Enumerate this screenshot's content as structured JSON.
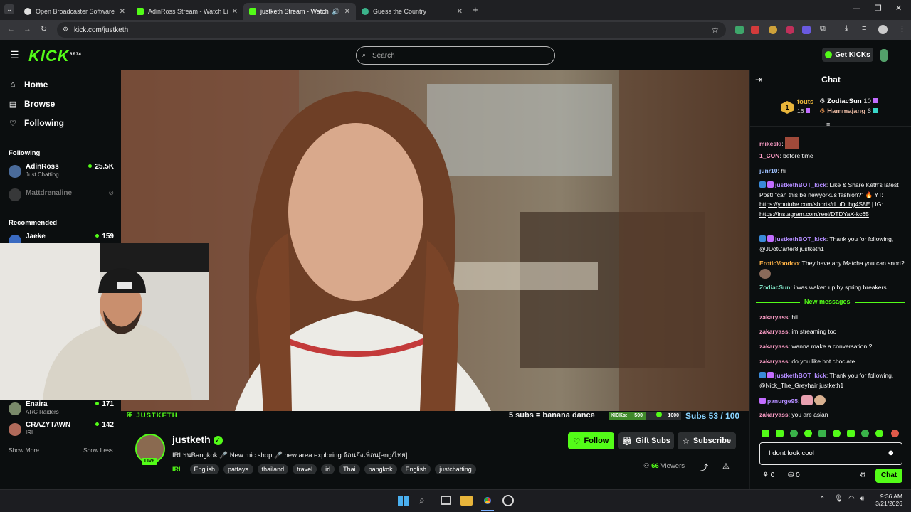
{
  "browser": {
    "tabs": [
      {
        "title": "Open Broadcaster Software | OBS",
        "favicon_color": "#e0e0e0",
        "active": false
      },
      {
        "title": "AdinRoss Stream - Watch Live on Kick",
        "favicon_color": "#53fc18",
        "active": false
      },
      {
        "title": "justketh Stream - Watch Live on Kick",
        "favicon_color": "#53fc18",
        "active": true
      },
      {
        "title": "Guess the Country",
        "favicon_color": "#3bb38a",
        "active": false
      }
    ],
    "url": "kick.com/justketh"
  },
  "header": {
    "logo_text": "KICK",
    "logo_beta": "BETA",
    "search_placeholder": "Search",
    "get_kicks_label": "Get KICKs",
    "accent": "#53fc18"
  },
  "sidebar": {
    "nav": [
      {
        "icon": "home-icon",
        "label": "Home"
      },
      {
        "icon": "browse-icon",
        "label": "Browse"
      },
      {
        "icon": "heart-icon",
        "label": "Following"
      }
    ],
    "following_title": "Following",
    "following": [
      {
        "name": "AdinRoss",
        "category": "Just Chatting",
        "viewers": "25.5K"
      },
      {
        "name": "Mattdrenaline",
        "offline": true
      }
    ],
    "recommended_title": "Recommended",
    "recommended": [
      {
        "name": "Jaeke",
        "viewers": "159"
      },
      {
        "name": "Enaira",
        "category": "ARC Raiders",
        "viewers": "171"
      },
      {
        "name": "CRAZYTAWN",
        "category": "IRL",
        "viewers": "142"
      }
    ],
    "show_more": "Show More",
    "show_less": "Show Less"
  },
  "overlay": {
    "channel_tag": "JUSTKETH",
    "goal_text": "5 subs = banana dance",
    "kicks_label": "KICKs:",
    "kicks_value": "500",
    "kicks_goal": "1000",
    "subs_text": "Subs 53 / 100"
  },
  "stream": {
    "channel_name": "justketh",
    "live_label": "LIVE",
    "title": "IRLฯนBangkok 🎤 New mic shop 🎤 new area exploring จ้อนยังเพื่อน[eng/ไทย]",
    "category": "IRL",
    "tags": [
      "English",
      "pattaya",
      "thailand",
      "travel",
      "irl",
      "Thai",
      "bangkok",
      "English",
      "justchatting"
    ],
    "follow_label": "Follow",
    "gift_label": "Gift Subs",
    "subscribe_label": "Subscribe",
    "viewers_count": "66",
    "viewers_label": "Viewers"
  },
  "chat": {
    "title": "Chat",
    "leaderboard": [
      {
        "name": "fouts",
        "count": "16"
      },
      {
        "name": "ZodiacSun",
        "count": "10"
      },
      {
        "name": "Hammajang",
        "count": "6"
      }
    ],
    "leader_rank": "1",
    "messages": [
      {
        "user": "mikeski",
        "color": "#ff9ec8",
        "text": ""
      },
      {
        "user": "1_CON",
        "color": "#ff9ec8",
        "text": "before time"
      },
      {
        "user": "junr10",
        "color": "#9ec1ff",
        "text": "hi"
      },
      {
        "user": "justkethBOT_kick",
        "color": "#b38cff",
        "text": "Like & Share Keth's latest Post! \"can this be newyorkus fashion?\" 🔥 YT:",
        "link1": "https://youtube.com/shorts/rLuDLhg4S8E",
        "sep": " | IG:",
        "link2": "https://instagram.com/reel/DTDYaX-kc65"
      },
      {
        "user": "justkethBOT_kick",
        "color": "#b38cff",
        "text": "Thank you for following, @JDotCarter8 justketh1"
      },
      {
        "user": "EroticVoodoo",
        "color": "#ffb347",
        "text": "They have any Matcha you can snort?"
      },
      {
        "user": "ZodiacSun",
        "color": "#7ee0c3",
        "text": "i was waken up by spring breakers"
      },
      {
        "user": "zakaryass",
        "color": "#ff9ec8",
        "text": "hii"
      },
      {
        "user": "zakaryass",
        "color": "#ff9ec8",
        "text": "im streaming too"
      },
      {
        "user": "zakaryass",
        "color": "#ff9ec8",
        "text": "wanna make a conversation ?"
      },
      {
        "user": "zakaryass",
        "color": "#ff9ec8",
        "text": "do you like hot choclate"
      },
      {
        "user": "justkethBOT_kick",
        "color": "#b38cff",
        "text": "Thank you for following, @Nick_The_Greyhair justketh1"
      },
      {
        "user": "panurge95",
        "color": "#b38cff",
        "text": ""
      },
      {
        "user": "zakaryass",
        "color": "#ff9ec8",
        "text": "you are asian"
      }
    ],
    "new_messages_label": "New messages",
    "input_value": "I dont look cool",
    "points_a": "0",
    "points_b": "0",
    "send_label": "Chat"
  },
  "taskbar": {
    "time": "9:36 AM",
    "date": "3/21/2026"
  }
}
